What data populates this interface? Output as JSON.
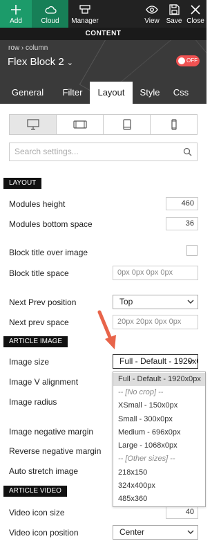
{
  "toolbar": {
    "add": "Add",
    "cloud": "Cloud",
    "manager": "Manager",
    "view": "View",
    "save": "Save",
    "close": "Close"
  },
  "content_bar": "CONTENT",
  "header": {
    "breadcrumb_row": "row",
    "breadcrumb_column": "column",
    "title": "Flex Block 2",
    "toggle": "OFF"
  },
  "tabs": [
    "General",
    "Filter",
    "Layout",
    "Style",
    "Css"
  ],
  "search": {
    "placeholder": "Search settings..."
  },
  "sections": {
    "layout": "LAYOUT",
    "article_image": "ARTICLE IMAGE",
    "article_video": "ARTICLE VIDEO"
  },
  "fields": {
    "modules_height": {
      "label": "Modules height",
      "value": "460"
    },
    "modules_bottom_space": {
      "label": "Modules bottom space",
      "value": "36"
    },
    "block_title_over_image": {
      "label": "Block title over image"
    },
    "block_title_space": {
      "label": "Block title space",
      "placeholder": "0px 0px 0px 0px"
    },
    "next_prev_position": {
      "label": "Next Prev position",
      "value": "Top"
    },
    "next_prev_space": {
      "label": "Next prev space",
      "placeholder": "20px 20px 0px 0px"
    },
    "image_size": {
      "label": "Image size",
      "value": "Full - Default - 1920x0px"
    },
    "image_v_alignment": {
      "label": "Image V alignment"
    },
    "image_radius": {
      "label": "Image radius"
    },
    "image_negative_margin": {
      "label": "Image negative margin"
    },
    "reverse_negative_margin": {
      "label": "Reverse negative margin"
    },
    "auto_stretch_image": {
      "label": "Auto stretch image"
    },
    "video_icon_size": {
      "label": "Video icon size",
      "value": "40"
    },
    "video_icon_position": {
      "label": "Video icon position",
      "value": "Center"
    }
  },
  "image_size_options": [
    {
      "label": "Full - Default - 1920x0px",
      "group": false,
      "selected": true
    },
    {
      "label": "-- [No crop] --",
      "group": true
    },
    {
      "label": "XSmall - 150x0px",
      "group": false
    },
    {
      "label": "Small - 300x0px",
      "group": false
    },
    {
      "label": "Medium - 696x0px",
      "group": false
    },
    {
      "label": "Large - 1068x0px",
      "group": false
    },
    {
      "label": "-- [Other sizes] --",
      "group": true
    },
    {
      "label": "218x150",
      "group": false
    },
    {
      "label": "324x400px",
      "group": false
    },
    {
      "label": "485x360",
      "group": false
    }
  ],
  "colors": {
    "add_bg": "#1c9b6a",
    "cloud_bg": "#177f57",
    "toggle_off": "#f05252",
    "annotation_arrow": "#e8644a"
  }
}
